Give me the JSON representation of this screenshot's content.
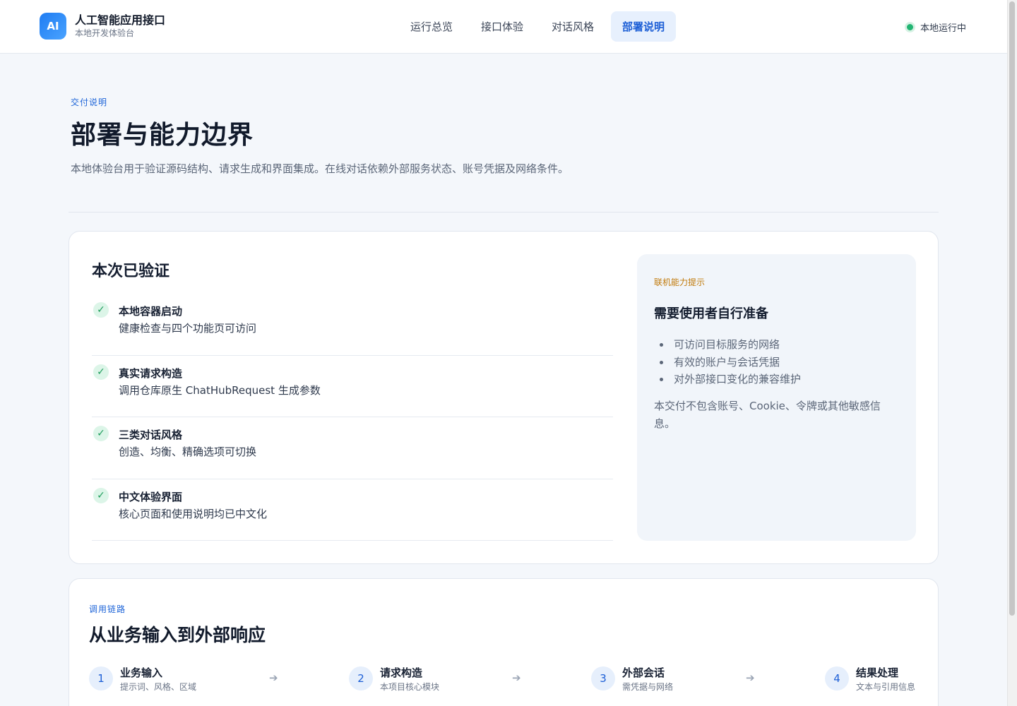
{
  "header": {
    "logo_text": "AI",
    "app_title": "人工智能应用接口",
    "app_subtitle": "本地开发体验台",
    "nav": [
      {
        "label": "运行总览",
        "active": false
      },
      {
        "label": "接口体验",
        "active": false
      },
      {
        "label": "对话风格",
        "active": false
      },
      {
        "label": "部署说明",
        "active": true
      }
    ],
    "status_text": "本地运行中",
    "status_color": "#22b573"
  },
  "hero": {
    "eyebrow": "交付说明",
    "title": "部署与能力边界",
    "description": "本地体验台用于验证源码结构、请求生成和界面集成。在线对话依赖外部服务状态、账号凭据及网络条件。"
  },
  "verified": {
    "title": "本次已验证",
    "items": [
      {
        "title": "本地容器启动",
        "desc": "健康检查与四个功能页可访问"
      },
      {
        "title": "真实请求构造",
        "desc": "调用仓库原生 ChatHubRequest 生成参数"
      },
      {
        "title": "三类对话风格",
        "desc": "创造、均衡、精确选项可切换"
      },
      {
        "title": "中文体验界面",
        "desc": "核心页面和使用说明均已中文化"
      }
    ]
  },
  "notice": {
    "eyebrow": "联机能力提示",
    "title": "需要使用者自行准备",
    "items": [
      "可访问目标服务的网络",
      "有效的账户与会话凭据",
      "对外部接口变化的兼容维护"
    ],
    "note": "本交付不包含账号、Cookie、令牌或其他敏感信息。"
  },
  "chain": {
    "eyebrow": "调用链路",
    "title": "从业务输入到外部响应",
    "steps": [
      {
        "num": "1",
        "title": "业务输入",
        "desc": "提示词、风格、区域"
      },
      {
        "num": "2",
        "title": "请求构造",
        "desc": "本项目核心模块"
      },
      {
        "num": "3",
        "title": "外部会话",
        "desc": "需凭据与网络"
      },
      {
        "num": "4",
        "title": "结果处理",
        "desc": "文本与引用信息"
      }
    ],
    "arrow": "➔"
  },
  "colors": {
    "accent": "#1d5fd6",
    "success": "#1f9d5c",
    "warning": "#c17a0b"
  }
}
